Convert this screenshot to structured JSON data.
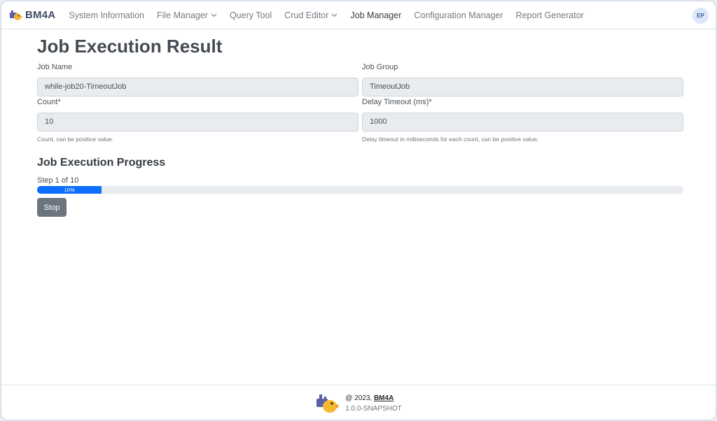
{
  "brand": {
    "name": "BM4A",
    "icon": "bm4a-logo-icon"
  },
  "nav": {
    "items": [
      {
        "label": "System Information",
        "dropdown": false,
        "active": false
      },
      {
        "label": "File Manager",
        "dropdown": true,
        "active": false
      },
      {
        "label": "Query Tool",
        "dropdown": false,
        "active": false
      },
      {
        "label": "Crud Editor",
        "dropdown": true,
        "active": false
      },
      {
        "label": "Job Manager",
        "dropdown": false,
        "active": true
      },
      {
        "label": "Configuration Manager",
        "dropdown": false,
        "active": false
      },
      {
        "label": "Report Generator",
        "dropdown": false,
        "active": false
      }
    ],
    "avatar_initials": "EP"
  },
  "page": {
    "title": "Job Execution Result",
    "fields": {
      "job_name": {
        "label": "Job Name",
        "value": "while-job20-TimeoutJob"
      },
      "job_group": {
        "label": "Job Group",
        "value": "TimeoutJob"
      },
      "count": {
        "label": "Count*",
        "value": "10",
        "help": "Count, can be positive value."
      },
      "delay_timeout": {
        "label": "Delay Timeout (ms)*",
        "value": "1000",
        "help": "Delay timeout in milliseconds for each count, can be positive value."
      }
    },
    "progress": {
      "title": "Job Execution Progress",
      "step_text": "Step 1 of 10",
      "percent": 10,
      "percent_label": "10%"
    },
    "stop_label": "Stop"
  },
  "footer": {
    "copyright_prefix": "@ 2023,",
    "brand": "BM4A",
    "version": "1.0.0-SNAPSHOT"
  },
  "colors": {
    "primary": "#0d6efd",
    "secondary": "#6c757d",
    "brand_text": "#3f4d66"
  }
}
